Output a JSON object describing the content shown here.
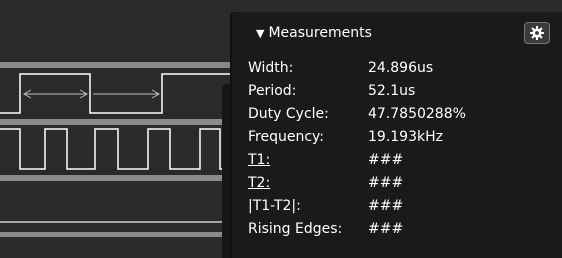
{
  "panel": {
    "title": "Measurements",
    "collapse_icon": "triangle-down-icon",
    "settings_icon": "gear-icon"
  },
  "measurements": [
    {
      "label": "Width:",
      "value": "24.896us",
      "link": false
    },
    {
      "label": "Period:",
      "value": "52.1us",
      "link": false
    },
    {
      "label": "Duty Cycle:",
      "value": "47.7850288%",
      "link": false
    },
    {
      "label": "Frequency:",
      "value": "19.193kHz",
      "link": false
    },
    {
      "label": "T1:",
      "value": "###",
      "link": true
    },
    {
      "label": "T2:",
      "value": "###",
      "link": true
    },
    {
      "label": "|T1-T2|:",
      "value": "###",
      "link": false
    },
    {
      "label": "Rising Edges:",
      "value": "###",
      "link": false
    }
  ],
  "colors": {
    "panel_background": "#1a1a1a",
    "waveform_background": "#2a2a2a",
    "trace": "#ffffff",
    "channel_separator": "#8a8a8a",
    "text": "#ffffff"
  }
}
